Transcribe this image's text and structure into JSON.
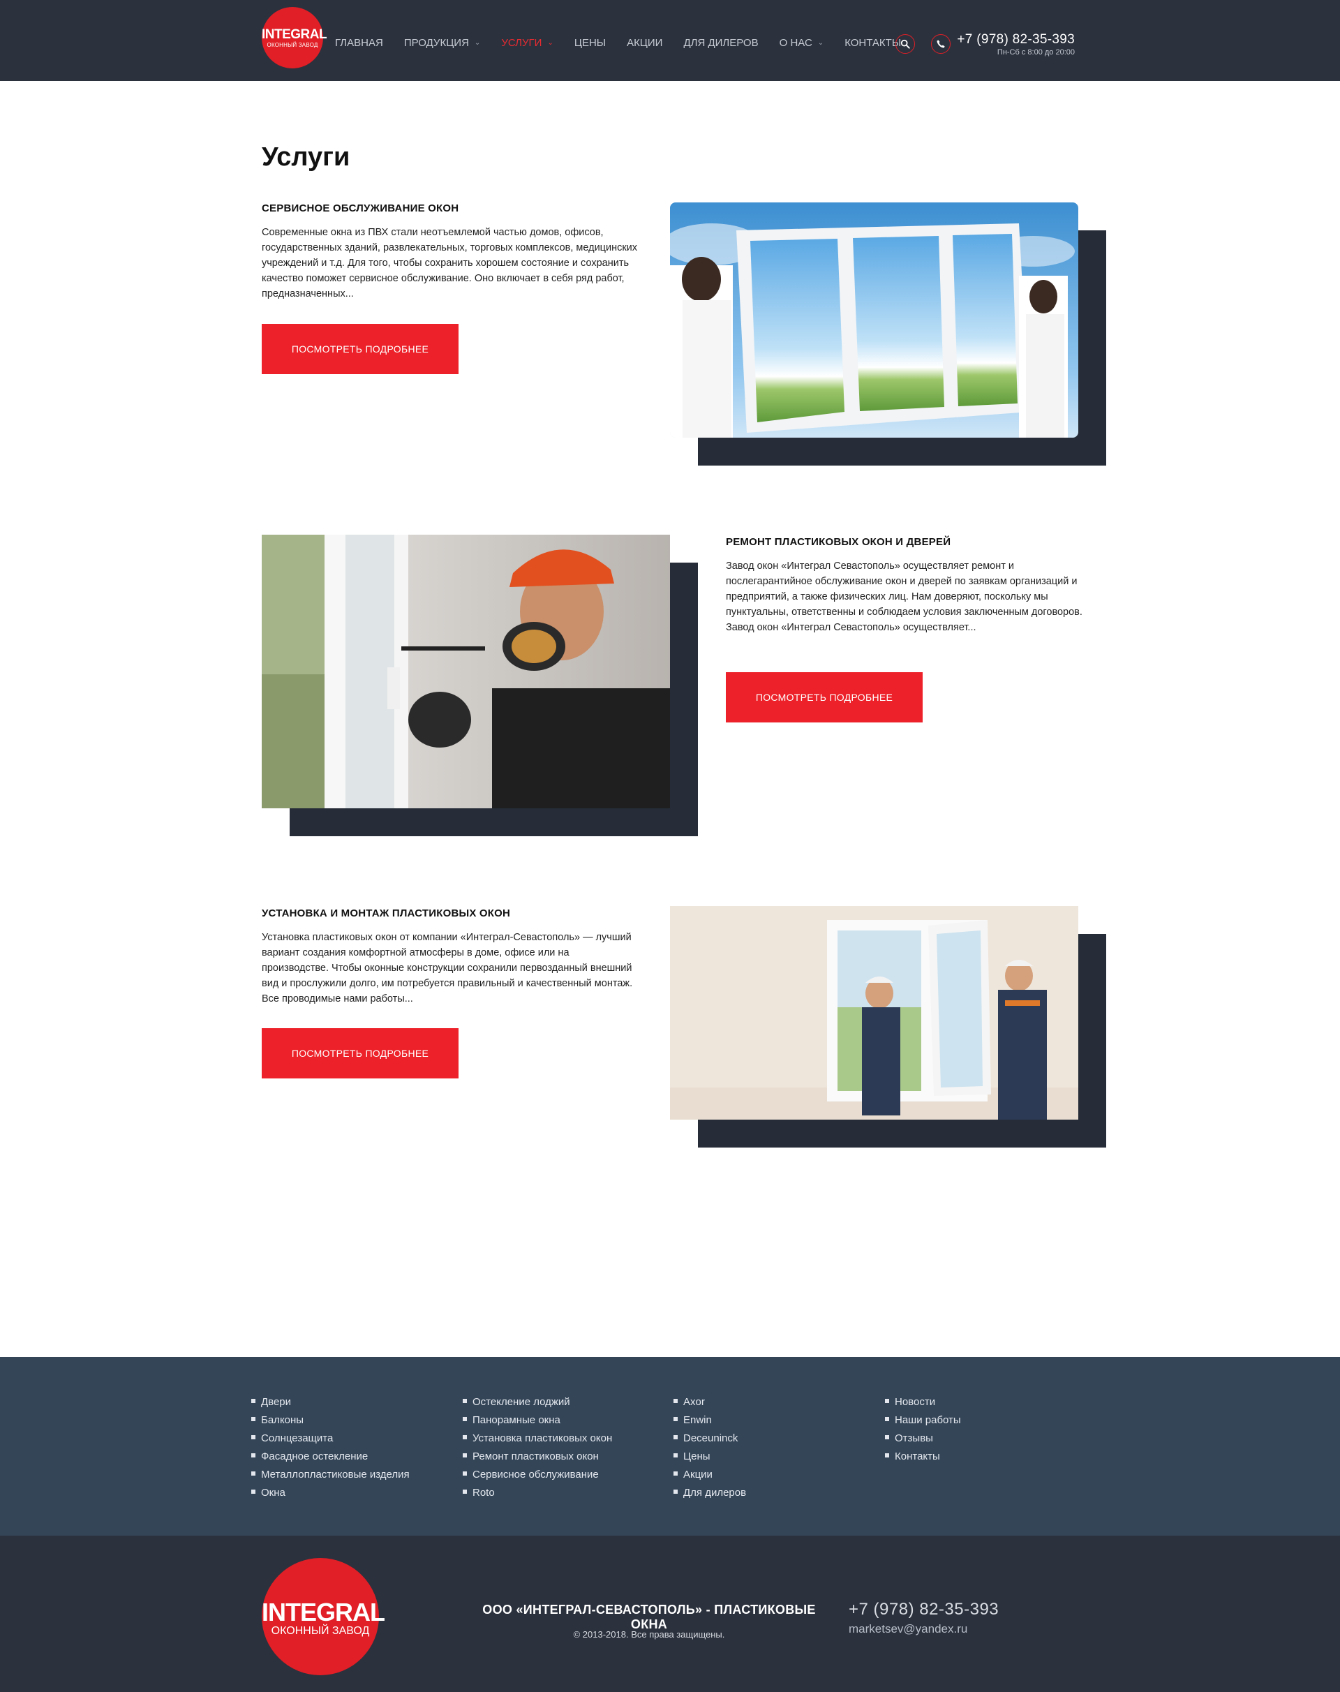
{
  "header": {
    "logo_main": "INTEGRAL",
    "logo_sub": "ОКОННЫЙ ЗАВОД",
    "nav": [
      {
        "label": "ГЛАВНАЯ",
        "has_dropdown": false,
        "active": false
      },
      {
        "label": "ПРОДУКЦИЯ",
        "has_dropdown": true,
        "active": false
      },
      {
        "label": "УСЛУГИ",
        "has_dropdown": true,
        "active": true
      },
      {
        "label": "ЦЕНЫ",
        "has_dropdown": false,
        "active": false
      },
      {
        "label": "АКЦИИ",
        "has_dropdown": false,
        "active": false
      },
      {
        "label": "ДЛЯ ДИЛЕРОВ",
        "has_dropdown": false,
        "active": false
      },
      {
        "label": "О НАС",
        "has_dropdown": true,
        "active": false
      },
      {
        "label": "КОНТАКТЫ",
        "has_dropdown": false,
        "active": false
      }
    ],
    "phone": "+7 (978) 82-35-393",
    "hours": "Пн-Сб с 8:00 до 20:00",
    "icons": [
      "search-icon",
      "phone-icon"
    ]
  },
  "page": {
    "title": "Услуги"
  },
  "services": [
    {
      "title": "СЕРВИСНОЕ ОБСЛУЖИВАНИЕ ОКОН",
      "text": "Современные окна из ПВХ стали неотъемлемой частью домов, офисов, государственных зданий, развлекательных, торговых комплексов, медицинских учреждений и т.д. Для того, чтобы сохранить хорошем состояние и сохранить качество поможет сервисное обслуживание. Оно включает в себя ряд работ, предназначенных...",
      "button": "ПОСМОТРЕТЬ ПОДРОБНЕЕ"
    },
    {
      "title": "РЕМОНТ ПЛАСТИКОВЫХ ОКОН И ДВЕРЕЙ",
      "text": "Завод окон «Интеграл Севастополь» осуществляет ремонт и послегарантийное обслуживание окон и дверей по заявкам организаций и предприятий, а также физических лиц. Нам доверяют, поскольку мы пунктуальны, ответственны и соблюдаем условия заключенным договоров. Завод окон «Интеграл Севастополь» осуществляет...",
      "button": "ПОСМОТРЕТЬ ПОДРОБНЕЕ"
    },
    {
      "title": "УСТАНОВКА И МОНТАЖ ПЛАСТИКОВЫХ ОКОН",
      "text": "Установка пластиковых окон от компании «Интеграл-Севастополь» — лучший вариант создания комфортной атмосферы в доме, офисе или на производстве. Чтобы оконные конструкции сохранили первозданный внешний вид и прослужили долго, им потребуется правильный и качественный монтаж. Все проводимые нами работы...",
      "button": "ПОСМОТРЕТЬ ПОДРОБНЕЕ"
    }
  ],
  "footer": {
    "columns": [
      [
        "Двери",
        "Балконы",
        "Солнцезащита",
        "Фасадное остекление",
        "Металлопластиковые изделия",
        "Окна"
      ],
      [
        "Остекление лоджий",
        "Панорамные окна",
        "Установка пластиковых окон",
        "Ремонт пластиковых окон",
        "Сервисное обслуживание",
        "Roto"
      ],
      [
        "Axor",
        "Enwin",
        "Deceuninck",
        "Цены",
        "Акции",
        "Для дилеров"
      ],
      [
        "Новости",
        "Наши работы",
        "Отзывы",
        "Контакты"
      ]
    ],
    "logo_main": "INTEGRAL",
    "logo_sub": "ОКОННЫЙ ЗАВОД",
    "company": "ООО «ИНТЕГРАЛ-СЕВАСТОПОЛЬ» - ПЛАСТИКОВЫЕ ОКНА",
    "copyright": "© 2013-2018. Все права защищены.",
    "phone": "+7 (978) 82-35-393",
    "email": "marketsev@yandex.ru"
  },
  "misc": {
    "stray_char": "\\"
  },
  "colors": {
    "header_bg": "#2b313d",
    "accent": "#ed2129",
    "footer_links_bg": "#344558",
    "shadow_block": "#262d38"
  }
}
